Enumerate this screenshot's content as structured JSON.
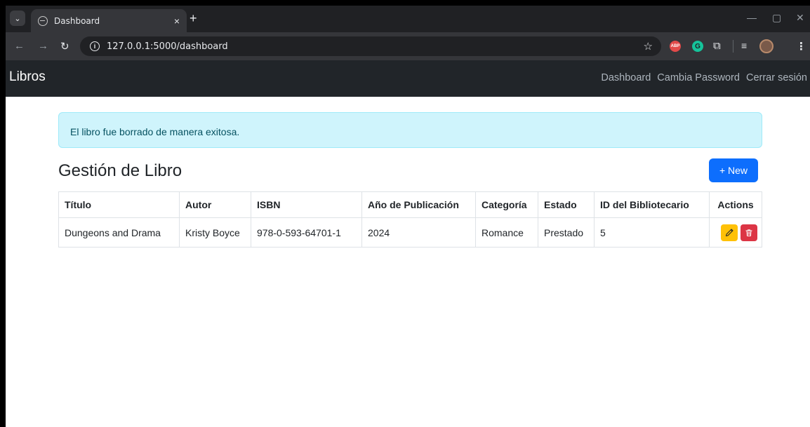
{
  "browser": {
    "tab_title": "Dashboard",
    "tab_close": "×",
    "new_tab": "+",
    "url": "127.0.0.1:5000/dashboard",
    "ext_abp_label": "ABP",
    "ext_g_label": "G"
  },
  "navbar": {
    "brand": "Libros",
    "links": [
      "Dashboard",
      "Cambia Password",
      "Cerrar sesión"
    ]
  },
  "alert": {
    "message": "El libro fue borrado de manera exitosa."
  },
  "page": {
    "title": "Gestión de Libro",
    "new_button": "+ New"
  },
  "table": {
    "headers": [
      "Título",
      "Autor",
      "ISBN",
      "Año de Publicación",
      "Categoría",
      "Estado",
      "ID del Bibliotecario",
      "Actions"
    ],
    "rows": [
      [
        "Dungeons and Drama",
        "Kristy Boyce",
        "978-0-593-64701-1",
        "2024",
        "Romance",
        "Prestado",
        "5"
      ]
    ]
  },
  "colors": {
    "navbar_bg": "#212529",
    "alert_bg": "#cff4fc",
    "primary": "#0d6efd",
    "warning": "#ffc107",
    "danger": "#dc3545"
  }
}
